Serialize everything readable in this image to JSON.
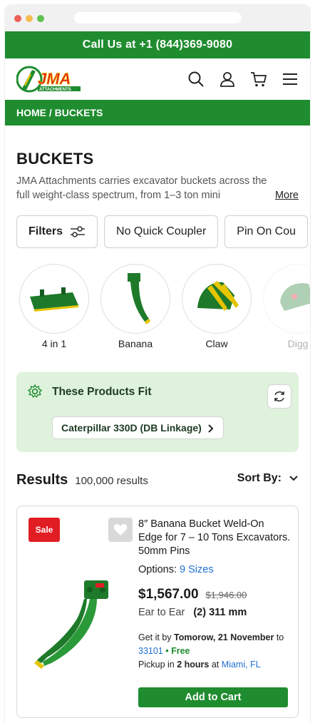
{
  "topbar": {
    "call_text": "Call Us at +1 (844)369-9080"
  },
  "logo": {
    "name": "JMA",
    "tagline": "ATTACHMENTS"
  },
  "header": {
    "icons": [
      "search-icon",
      "user-icon",
      "cart-icon",
      "menu-icon"
    ]
  },
  "breadcrumb": {
    "text": "HOME / BUCKETS"
  },
  "page": {
    "title": "BUCKETS",
    "description": "JMA Attachments carries excavator buckets across the full weight-class spectrum, from 1–3 ton mini",
    "more_label": "More"
  },
  "filters": {
    "filters_label": "Filters",
    "chips": [
      "No Quick Coupler",
      "Pin On Cou"
    ]
  },
  "categories": [
    {
      "label": "4 in 1"
    },
    {
      "label": "Banana"
    },
    {
      "label": "Claw"
    },
    {
      "label": "Digg"
    }
  ],
  "fit": {
    "title": "These Products Fit",
    "vehicle": "Caterpillar 330D (DB Linkage)"
  },
  "results": {
    "title": "Results",
    "count": "100,000 results",
    "sort_label": "Sort By:"
  },
  "product": {
    "badge": "Sale",
    "name": "8″ Banana Bucket Weld-On Edge for 7 – 10 Tons Excavators. 50mm Pins",
    "options_label": "Options:",
    "options_value": "9 Sizes",
    "price": "$1,567.00",
    "old_price": "$1,946.00",
    "spec_label": "Ear to Ear",
    "spec_value": "(2) 311 mm",
    "delivery_prefix": "Get it by",
    "delivery_date": "Tomorow, 21 November",
    "delivery_to": "to",
    "zip": "33101",
    "shipping": "• Free",
    "pickup_prefix": "Pickup in",
    "pickup_time": "2 hours",
    "pickup_at": "at",
    "pickup_location": "Miami, FL",
    "cart_label": "Add to Cart"
  },
  "colors": {
    "brand_green": "#1f8c2f",
    "fit_bg": "#dff2dc",
    "sale_red": "#e11d24",
    "link_blue": "#1f6fd0"
  }
}
